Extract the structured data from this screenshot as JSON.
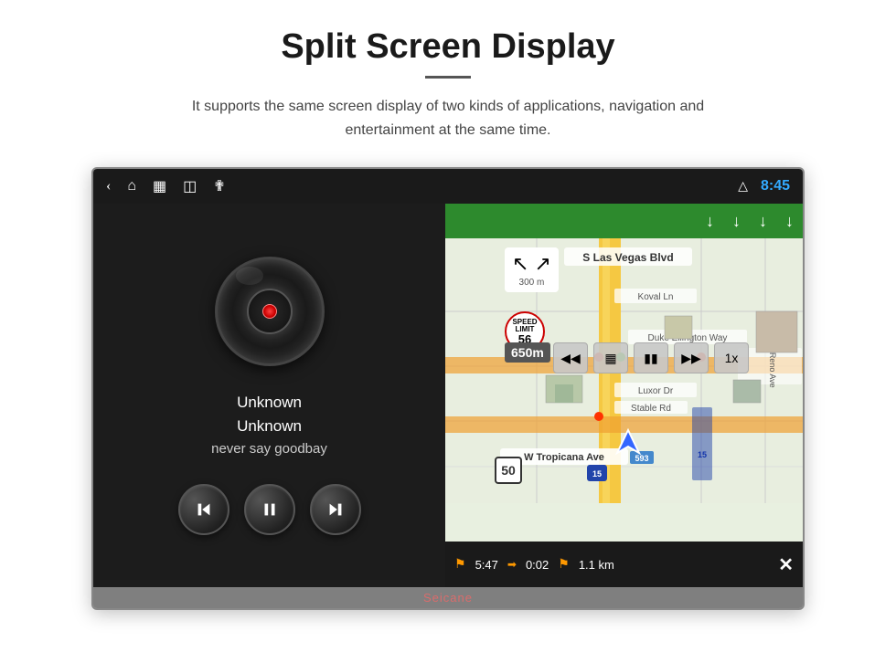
{
  "page": {
    "title": "Split Screen Display",
    "subtitle": "It supports the same screen display of two kinds of applications, navigation and entertainment at the same time."
  },
  "status_bar": {
    "time": "8:45",
    "icons": [
      "back",
      "home",
      "recent",
      "gallery",
      "usb",
      "eject"
    ]
  },
  "media_player": {
    "track_title": "Unknown",
    "track_artist": "Unknown",
    "track_album": "never say goodbay",
    "controls": [
      "prev",
      "play-pause",
      "next"
    ]
  },
  "navigation": {
    "top_arrows": [
      "↓",
      "↓",
      "↓",
      "↓"
    ],
    "road_name": "S Las Vegas Blvd",
    "cross_street": "Koval Ln",
    "turn_distance": "300 m",
    "dist_to_turn": "650m",
    "speed_limit": "56",
    "current_speed": "50",
    "bottom_bar": {
      "time": "5:47",
      "elapsed": "0:02",
      "distance": "1.1 km"
    },
    "playback_controls": [
      "prev",
      "checkerboard",
      "pause",
      "next",
      "1x"
    ]
  },
  "watermark": "Seicane"
}
